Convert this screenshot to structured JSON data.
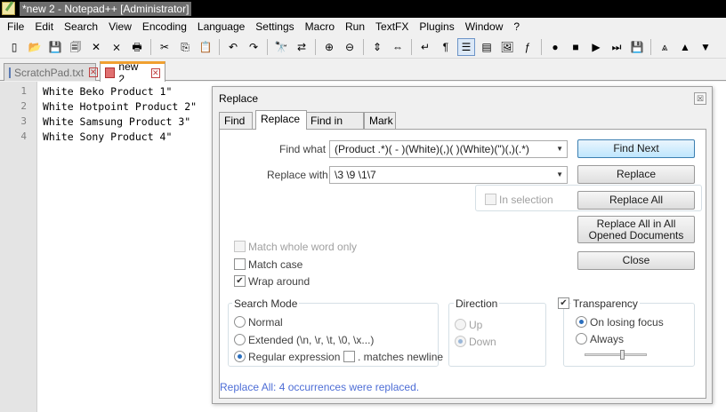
{
  "window": {
    "title": "*new  2 - Notepad++ [Administrator]"
  },
  "menubar": [
    "File",
    "Edit",
    "Search",
    "View",
    "Encoding",
    "Language",
    "Settings",
    "Macro",
    "Run",
    "TextFX",
    "Plugins",
    "Window",
    "?"
  ],
  "toolbar": {
    "icons": [
      {
        "name": "new-file-icon",
        "glyph": "▯"
      },
      {
        "name": "open-file-icon",
        "glyph": "📂"
      },
      {
        "name": "save-icon",
        "glyph": "💾"
      },
      {
        "name": "save-all-icon",
        "glyph": "🗐"
      },
      {
        "name": "close-icon",
        "glyph": "✕"
      },
      {
        "name": "close-all-icon",
        "glyph": "⨯"
      },
      {
        "name": "print-icon",
        "glyph": "🖶"
      },
      {
        "name": "cut-icon",
        "glyph": "✂"
      },
      {
        "name": "copy-icon",
        "glyph": "⎘"
      },
      {
        "name": "paste-icon",
        "glyph": "📋"
      },
      {
        "name": "undo-icon",
        "glyph": "↶"
      },
      {
        "name": "redo-icon",
        "glyph": "↷"
      },
      {
        "name": "find-icon",
        "glyph": "🔭"
      },
      {
        "name": "replace-icon",
        "glyph": "⇄"
      },
      {
        "name": "zoom-in-icon",
        "glyph": "⊕"
      },
      {
        "name": "zoom-out-icon",
        "glyph": "⊖"
      },
      {
        "name": "sync-vertical-icon",
        "glyph": "⇕"
      },
      {
        "name": "sync-horizontal-icon",
        "glyph": "⇔"
      },
      {
        "name": "word-wrap-icon",
        "glyph": "↵"
      },
      {
        "name": "show-all-chars-icon",
        "glyph": "¶"
      },
      {
        "name": "indent-guide-icon",
        "glyph": "☰"
      },
      {
        "name": "user-lang-icon",
        "glyph": "▤"
      },
      {
        "name": "doc-map-icon",
        "glyph": "🖼"
      },
      {
        "name": "function-list-icon",
        "glyph": "ƒ"
      },
      {
        "name": "record-macro-icon",
        "glyph": "●"
      },
      {
        "name": "stop-record-icon",
        "glyph": "■"
      },
      {
        "name": "play-macro-icon",
        "glyph": "▶"
      },
      {
        "name": "play-multiple-icon",
        "glyph": "⏭"
      },
      {
        "name": "save-macro-icon",
        "glyph": "💾"
      },
      {
        "name": "trim-icon",
        "glyph": "⩓"
      },
      {
        "name": "move-up-icon",
        "glyph": "▲"
      },
      {
        "name": "move-down-icon",
        "glyph": "▼"
      }
    ]
  },
  "doc_tabs": [
    {
      "label": "ScratchPad.txt",
      "active": false
    },
    {
      "label": "new  2",
      "active": true
    }
  ],
  "editor": {
    "line_numbers": [
      "1",
      "2",
      "3",
      "4"
    ],
    "lines": [
      "White Beko Product 1\"",
      "White Hotpoint Product 2\"",
      "White Samsung Product 3\"",
      "White Sony Product 4\""
    ]
  },
  "dialog": {
    "title": "Replace",
    "close_glyph": "☒",
    "tabs": [
      "Find",
      "Replace",
      "Find in Files",
      "Mark"
    ],
    "find_what_label": "Find what :",
    "find_what_value": "(Product .*)( - )(White)(,)( )(White)(\")(,)(.*)",
    "replace_with_label": "Replace with :",
    "replace_with_value": "\\3 \\9 \\1\\7",
    "in_selection_label": "In selection",
    "buttons": {
      "find_next": "Find Next",
      "replace": "Replace",
      "replace_all": "Replace All",
      "replace_all_opened": "Replace All in All Opened Documents",
      "close": "Close"
    },
    "options": {
      "match_whole_word": "Match whole word only",
      "match_case": "Match case",
      "wrap_around": "Wrap around"
    },
    "search_mode": {
      "title": "Search Mode",
      "normal": "Normal",
      "extended": "Extended (\\n, \\r, \\t, \\0, \\x...)",
      "regex": "Regular expression",
      "matches_newline": ". matches newline"
    },
    "direction": {
      "title": "Direction",
      "up": "Up",
      "down": "Down"
    },
    "transparency": {
      "title": "Transparency",
      "on_losing_focus": "On losing focus",
      "always": "Always",
      "level": 0.6
    },
    "status": "Replace All: 4 occurrences were replaced."
  }
}
